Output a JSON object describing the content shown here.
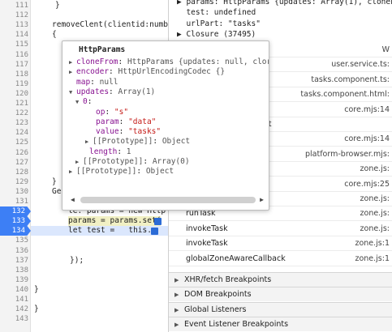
{
  "editor": {
    "lines": [
      {
        "n": "111",
        "code": "}"
      },
      {
        "n": "112",
        "code": ""
      },
      {
        "n": "113",
        "code": "removeClent(clientid:numb"
      },
      {
        "n": "114",
        "code": "{"
      },
      {
        "n": "115",
        "code": ""
      },
      {
        "n": "116",
        "code": ""
      },
      {
        "n": "117",
        "code": ""
      },
      {
        "n": "118",
        "code": ""
      },
      {
        "n": "119",
        "code": ""
      },
      {
        "n": "120",
        "code": ""
      },
      {
        "n": "121",
        "code": ""
      },
      {
        "n": "122",
        "code": ""
      },
      {
        "n": "123",
        "code": ""
      },
      {
        "n": "124",
        "code": ""
      },
      {
        "n": "125",
        "code": ""
      },
      {
        "n": "126",
        "code": ""
      },
      {
        "n": "127",
        "code": ""
      },
      {
        "n": "128",
        "code": ""
      },
      {
        "n": "129",
        "code": "}"
      },
      {
        "n": "130",
        "code": "Get"
      },
      {
        "n": "131",
        "code": ""
      },
      {
        "n": "132",
        "code": "le. params = new Http"
      },
      {
        "n": "133",
        "code": "params = params.set("
      },
      {
        "n": "134",
        "code": "let test =   this."
      },
      {
        "n": "135",
        "code": ""
      },
      {
        "n": "136",
        "code": ""
      },
      {
        "n": "137",
        "code": "});"
      },
      {
        "n": "138",
        "code": ""
      },
      {
        "n": "139",
        "code": ""
      },
      {
        "n": "140",
        "code": "}"
      },
      {
        "n": "141",
        "code": ""
      },
      {
        "n": "142",
        "code": "}"
      },
      {
        "n": "143",
        "code": ""
      }
    ]
  },
  "popover": {
    "title": "HttpParams",
    "rows": [
      {
        "arrow": "▶",
        "key": "cloneFrom",
        "val": "HttpParams {updates: null, clor"
      },
      {
        "arrow": "▶",
        "key": "encoder",
        "val": "HttpUrlEncodingCodec {}"
      },
      {
        "arrow": "",
        "key": "map",
        "val": "null"
      },
      {
        "arrow": "▼",
        "key": "updates",
        "val": "Array(1)"
      },
      {
        "arrow": "▼",
        "key": "0",
        "val": ""
      },
      {
        "arrow": "",
        "key": "op",
        "val": "\"s\""
      },
      {
        "arrow": "",
        "key": "param",
        "val": "\"data\""
      },
      {
        "arrow": "",
        "key": "value",
        "val": "\"tasks\""
      },
      {
        "arrow": "▶",
        "key": "[[Prototype]]",
        "val": "Object"
      },
      {
        "arrow": "",
        "key": "length",
        "val": "1"
      },
      {
        "arrow": "▶",
        "key": "[[Prototype]]",
        "val": "Array(0)"
      },
      {
        "arrow": "▶",
        "key": "[[Prototype]]",
        "val": "Object"
      }
    ],
    "scroll_left": "◀",
    "scroll_right": "▶"
  },
  "scope": {
    "rows": [
      {
        "text": "▶ params: HttpParams {updates: Array(1), cloneFr"
      },
      {
        "text": "  test: undefined"
      },
      {
        "text": "  urlPart: \"tasks\""
      },
      {
        "text": "▶ Closure (37495)"
      }
    ]
  },
  "call_stack": [
    {
      "name": "",
      "loc": "W"
    },
    {
      "name": "",
      "loc": "user.service.ts:"
    },
    {
      "name": "",
      "loc": "tasks.component.ts:"
    },
    {
      "name": "",
      "loc": "tasks.component.html:"
    },
    {
      "name": "orHandling",
      "loc": "core.mjs:14"
    },
    {
      "name": "irtyAndPreventDefault",
      "loc": ""
    },
    {
      "name": "",
      "loc": "core.mjs:14"
    },
    {
      "name": "",
      "loc": "platform-browser.mjs:"
    },
    {
      "name": "",
      "loc": "zone.js:"
    },
    {
      "name": "",
      "loc": "core.mjs:25"
    },
    {
      "name": "",
      "loc": "zone.js:"
    },
    {
      "name": "runTask",
      "loc": "zone.js:"
    },
    {
      "name": "invokeTask",
      "loc": "zone.js:"
    },
    {
      "name": "invokeTask",
      "loc": "zone.js:1"
    },
    {
      "name": "globalZoneAwareCallback",
      "loc": "zone.js:1"
    }
  ],
  "sections": [
    {
      "label": "XHR/fetch Breakpoints"
    },
    {
      "label": "DOM Breakpoints"
    },
    {
      "label": "Global Listeners"
    },
    {
      "label": "Event Listener Breakpoints"
    }
  ],
  "colors": {
    "breakpoint": "#3d7ff5",
    "current_line": "#dbe7fd"
  }
}
